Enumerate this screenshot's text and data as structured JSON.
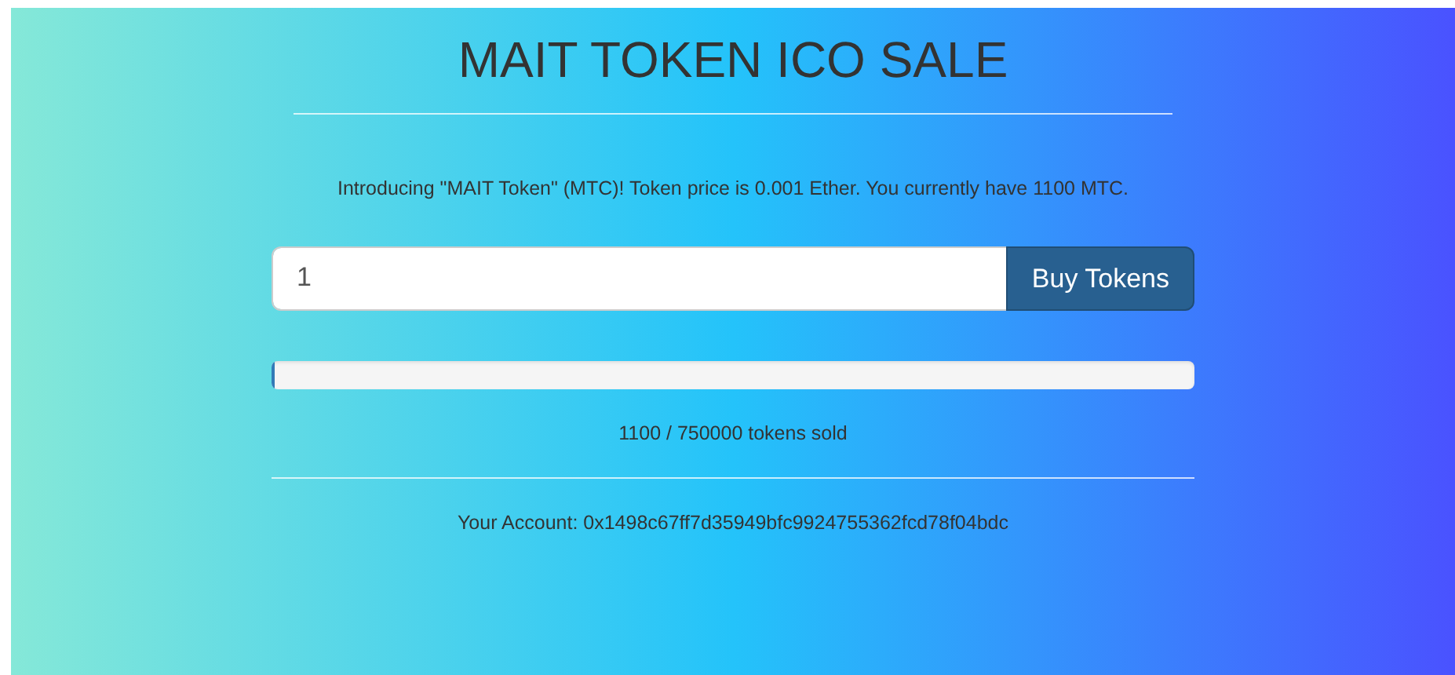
{
  "title": "MAIT TOKEN ICO SALE",
  "intro": "Introducing \"MAIT Token\" (MTC)! Token price is 0.001 Ether. You currently have 1100 MTC.",
  "purchase": {
    "value": "1",
    "button": "Buy Tokens"
  },
  "progress": {
    "level": 0.0015,
    "reading": "1100 / 750000 tokens sold"
  },
  "account": "Your Account: 0x1498c67ff7d35949bfc9924755362fcd78f04bdc"
}
